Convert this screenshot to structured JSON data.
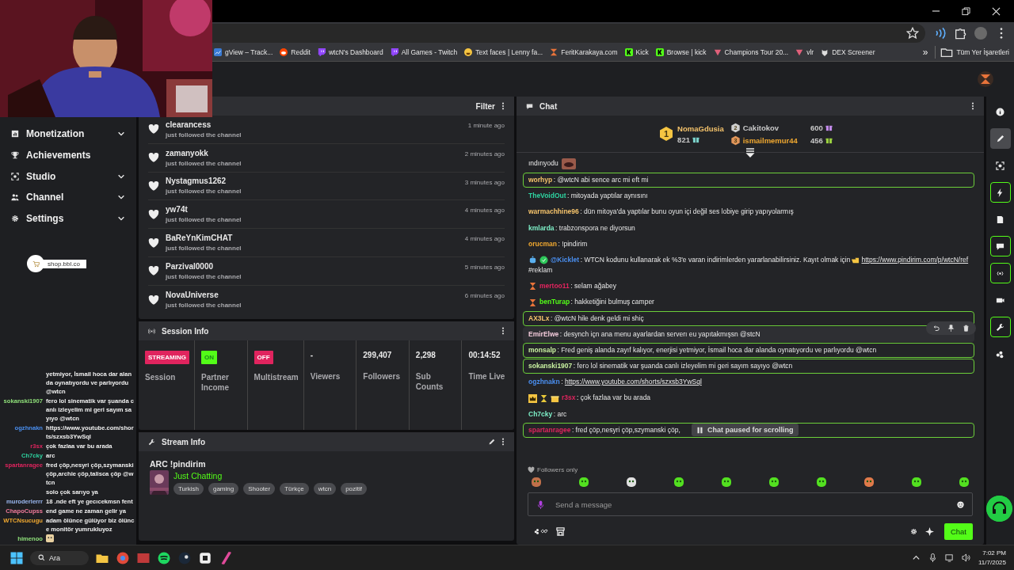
{
  "bookmarks": [
    {
      "label": "gView – Track...",
      "kind": "chart"
    },
    {
      "label": "Reddit",
      "kind": "reddit"
    },
    {
      "label": "wtcN's Dashboard",
      "kind": "twitch"
    },
    {
      "label": "All Games - Twitch",
      "kind": "twitch"
    },
    {
      "label": "Text faces | Lenny fa...",
      "kind": "face"
    },
    {
      "label": "FeritKarakaya.com",
      "kind": "logo"
    },
    {
      "label": "Kick",
      "kind": "kick"
    },
    {
      "label": "Browse | kick",
      "kind": "kick"
    },
    {
      "label": "Champions Tour 20...",
      "kind": "gem"
    },
    {
      "label": "vlr",
      "kind": "gem"
    },
    {
      "label": "DEX Screener",
      "kind": "dex"
    }
  ],
  "bookmarks_more": "»",
  "all_bookmarks": "Tüm Yer İşaretleri",
  "sidebar": {
    "items": [
      {
        "label": "Monetization",
        "kind": "group"
      },
      {
        "label": "Achievements",
        "kind": "link"
      },
      {
        "label": "Studio",
        "kind": "group"
      },
      {
        "label": "Channel",
        "kind": "group"
      },
      {
        "label": "Settings",
        "kind": "group"
      }
    ],
    "shop": "shop.bbl.co"
  },
  "activity": {
    "filter": "Filter",
    "items": [
      {
        "user": "clearancess",
        "action": "just followed the channel",
        "time": "1 minute ago"
      },
      {
        "user": "zamanyokk",
        "action": "just followed the channel",
        "time": "2 minutes ago"
      },
      {
        "user": "Nystagmus1262",
        "action": "just followed the channel",
        "time": "3 minutes ago"
      },
      {
        "user": "yw74t",
        "action": "just followed the channel",
        "time": "4 minutes ago"
      },
      {
        "user": "BaReYnKimCHAT",
        "action": "just followed the channel",
        "time": "4 minutes ago"
      },
      {
        "user": "Parzival0000",
        "action": "just followed the channel",
        "time": "5 minutes ago"
      },
      {
        "user": "NovaUniverse",
        "action": "just followed the channel",
        "time": "6 minutes ago"
      }
    ]
  },
  "session_info": {
    "title": "Session Info",
    "stats": [
      {
        "kind": "badge",
        "value": "STREAMING",
        "label": "Session",
        "color": "#e0245e"
      },
      {
        "kind": "badge",
        "value": "ON",
        "label": "Partner Income",
        "color": "#53fc18"
      },
      {
        "kind": "badge",
        "value": "OFF",
        "label": "Multistream",
        "color": "#e0245e"
      },
      {
        "kind": "number",
        "value": "-",
        "label": "Viewers"
      },
      {
        "kind": "number",
        "value": "299,407",
        "label": "Followers"
      },
      {
        "kind": "number",
        "value": "2,298",
        "label": "Sub Counts"
      },
      {
        "kind": "number",
        "value": "00:14:52",
        "label": "Time Live"
      }
    ]
  },
  "stream_info": {
    "title": "Stream Info",
    "stream_title": "ARC !pindirim",
    "category": "Just Chatting",
    "tags": [
      "Turkish",
      "gaming",
      "Shooter",
      "Türkçe",
      "wtcn",
      "pozitif"
    ]
  },
  "chat": {
    "title": "Chat",
    "leaders": [
      {
        "rank": "1",
        "name": "NomaGdusia",
        "count": "821"
      },
      {
        "rank": "2",
        "name": "Cakitokov",
        "count": "600"
      },
      {
        "rank": "3",
        "name": "ismailmemur44",
        "count": "456"
      }
    ],
    "messages": [
      {
        "kind": "emote_only",
        "text": "ındırıyodu"
      },
      {
        "kind": "highlight",
        "name": "worhyp",
        "color": "#f5c36b",
        "text": ": @wtcN abi sence arc mi eft mi"
      },
      {
        "kind": "normal",
        "name": "TheVoidOut",
        "color": "#2ed3a0",
        "text": ": mitoyada yaptılar aynısını"
      },
      {
        "kind": "normal",
        "name": "warmachhine96",
        "color": "#f5c36b",
        "text": ": dün mitoya'da yaptılar bunu oyun içi değil ses lobiye girip yapıyolarmış"
      },
      {
        "kind": "normal",
        "name": "kmlarda",
        "color": "#7ef0c8",
        "text": ": trabzonspora ne diyorsun"
      },
      {
        "kind": "normal",
        "name": "orucman",
        "color": "#f0a830",
        "text": ": !pindirim"
      },
      {
        "kind": "bot",
        "name": "@Kicklet",
        "color": "#4a8ff0",
        "text": ": WTCN kodunu kullanarak ek %3'e varan indirimlerden yararlanabilirsiniz. Kayıt olmak için",
        "link": "https://www.pindirim.com/p/wtcN/ref",
        "after": " #reklam"
      },
      {
        "kind": "badged",
        "name": "mertoo11",
        "color": "#e0245e",
        "text": ": selam ağabey"
      },
      {
        "kind": "badged",
        "name": "benTurap",
        "color": "#53fc18",
        "text": ": hakketiğini bulmuş camper"
      },
      {
        "kind": "highlight",
        "name": "AX3Lx",
        "color": "#f5c36b",
        "text": ": @wtcN hile denk geldi mi shiç"
      },
      {
        "kind": "hover",
        "name": "EmirElwe",
        "color": "#f0c8d8",
        "text": ": desynch içn ana menu ayarlardan serverı eu yapıtakmışsn @stcN"
      },
      {
        "kind": "highlight",
        "name": "monsalp",
        "color": "#c8f0a0",
        "text": ": Fred geniş alanda zayıf kalıyor, enerjisi yetmiyor, İsmail hoca dar alanda oynatıyordu ve parlıyordu @wtcn"
      },
      {
        "kind": "highlight",
        "name": "sokanski1907",
        "color": "#c8f0a0",
        "text": ": fero lol sinematik var şuanda canlı izleyelim mi geri sayım sayıyo @wtcn"
      },
      {
        "kind": "link",
        "name": "ogzhnakn",
        "color": "#4a8ff0",
        "text": ": ",
        "link": "https://www.youtube.com/shorts/szxsb3YwSql"
      },
      {
        "kind": "badged3",
        "name": "r3sx",
        "color": "#e0245e",
        "text": ": çok fazlaa var bu arada"
      },
      {
        "kind": "normal",
        "name": "Ch7cky",
        "color": "#7ef0c8",
        "text": ": arc"
      },
      {
        "kind": "highlight",
        "name": "spartanragee",
        "color": "#e0245e",
        "text": ": fred çöp,nesyri çöp,szymanski çöp,"
      }
    ],
    "paused": "Chat paused for scrolling",
    "followers_only": "Followers only",
    "input_placeholder": "Send a message",
    "send": "Chat"
  },
  "rail": [
    {
      "kind": "info",
      "outlined": false,
      "selected": false
    },
    {
      "kind": "pencil",
      "outlined": false,
      "selected": true
    },
    {
      "kind": "scan",
      "outlined": false,
      "selected": false
    },
    {
      "kind": "bolt",
      "outlined": true,
      "selected": false
    },
    {
      "kind": "doc",
      "outlined": false,
      "selected": false
    },
    {
      "kind": "chat",
      "outlined": true,
      "selected": false
    },
    {
      "kind": "broadcast",
      "outlined": true,
      "selected": false
    },
    {
      "kind": "camera",
      "outlined": false,
      "selected": false
    },
    {
      "kind": "wrench",
      "outlined": true,
      "selected": false
    },
    {
      "kind": "dots",
      "outlined": false,
      "selected": false
    }
  ],
  "overlay_chat": [
    {
      "text": "yetmiyor, İsmail hoca dar alanda oynatıyordu ve parlıyordu @wtcn"
    },
    {
      "name": "sokanski1907",
      "color": "#8fe07a",
      "text": "fero lol sinematik var şuanda canlı izleyelim mi geri sayım sayıyo @wtcn"
    },
    {
      "name": "ogzhnakn",
      "color": "#4a8ff0",
      "text": "https://www.youtube.com/shorts/szxsb3YwSql"
    },
    {
      "name": "r3sx",
      "color": "#e0245e",
      "text": "çok fazlaa var bu arada"
    },
    {
      "name": "Ch7cky",
      "color": "#2ed3a0",
      "text": "arc"
    },
    {
      "name": "spartanragee",
      "color": "#e0245e",
      "text": "fred çöp,nesyri çöp,szymanski çöp,archie çöp,talisca çöp @wtcn"
    },
    {
      "text": "solo çok sarıyo ya"
    },
    {
      "name": "muroderlerrr",
      "color": "#9ab8f0",
      "text": "18 .nde eft ye gecıcekmsn fent"
    },
    {
      "name": "ChapoCupss",
      "color": "#f07a9a",
      "text": "end game ne zaman gelir ya"
    },
    {
      "name": "WTCNsucugu",
      "color": "#f0a830",
      "text": "adam ölünce gülüyor biz ölünce monitör yumrukluyoz"
    },
    {
      "name": "himenoo",
      "color": "#8fe07a"
    }
  ],
  "taskbar": {
    "search": "Ara",
    "time": "7:02 PM",
    "date": "11/7/2025"
  }
}
